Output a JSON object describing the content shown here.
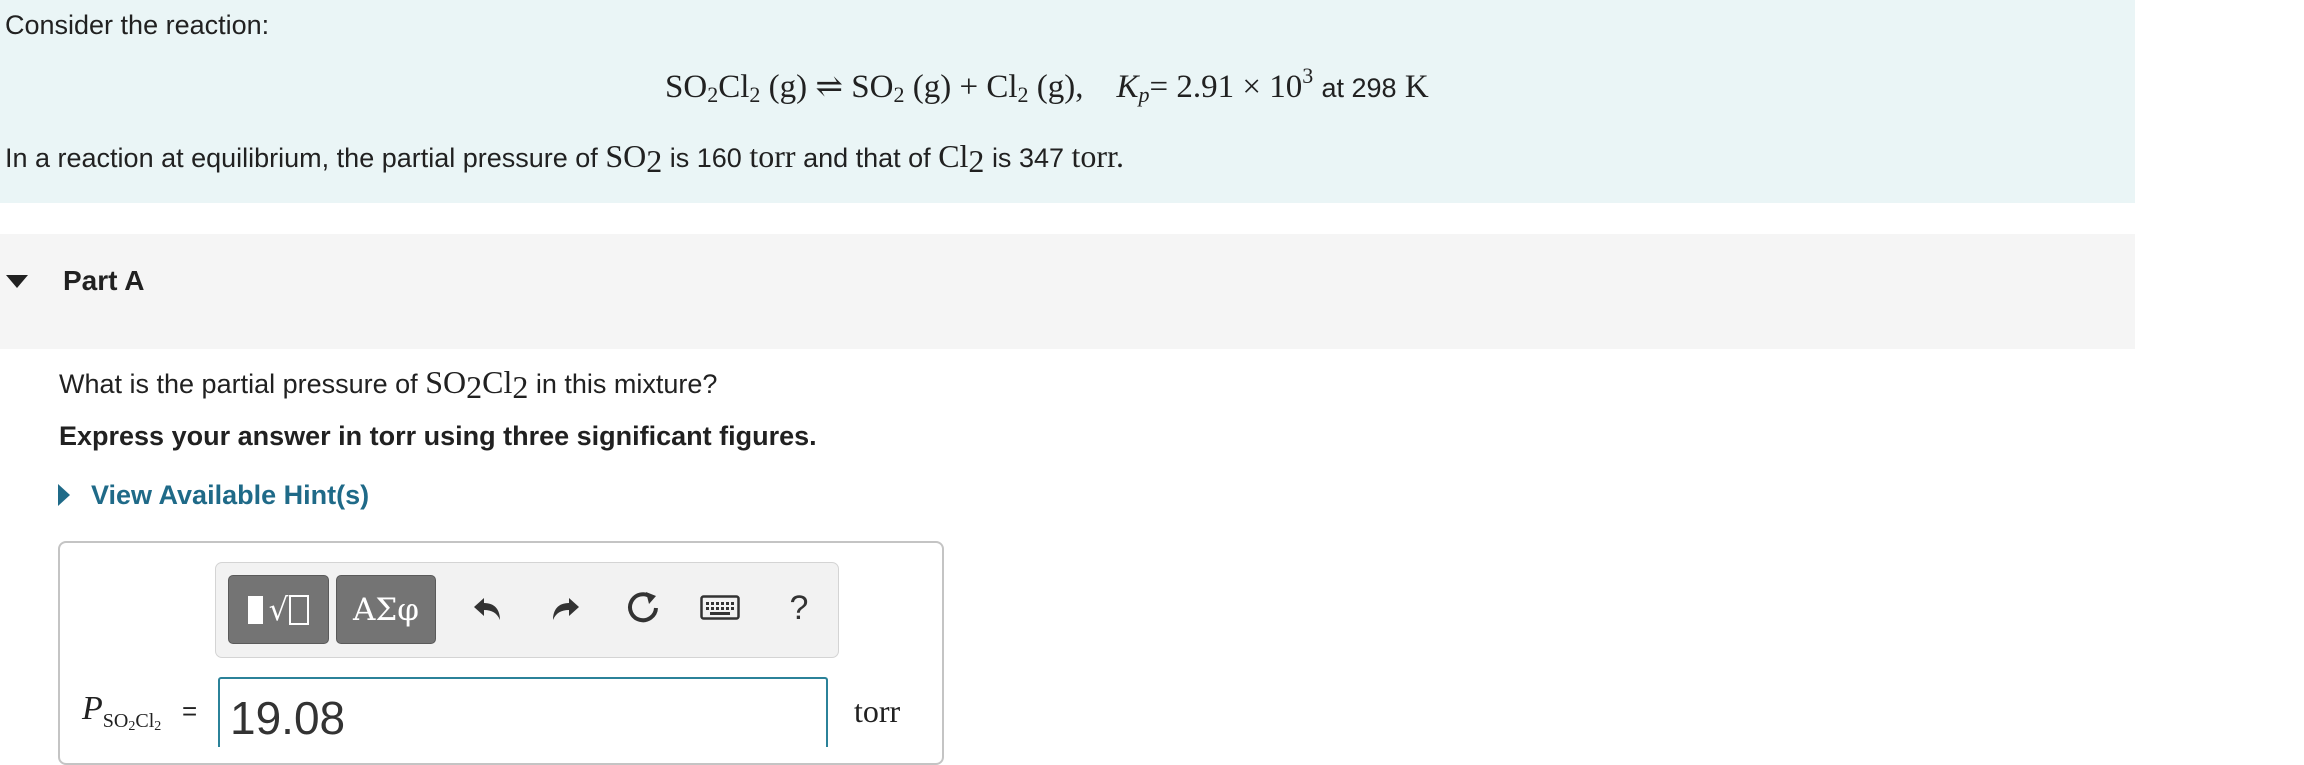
{
  "intro": {
    "heading": "Consider the reaction:",
    "equation": {
      "so2cl2_text": "SO",
      "sub2": "2",
      "cl_text": "Cl",
      "sub2b": "2",
      "gas": "(g)",
      "arrow": "⇌",
      "so2_text": "SO",
      "plus": "+",
      "cl2_text": "Cl",
      "comma": ",",
      "kp_symbol": "K",
      "kp_sub": "p",
      "kp_eq": "= 2.91 × 10",
      "kp_exp": "3",
      "at_text": "at 298",
      "kelvin": "K"
    },
    "equilibrium": {
      "part1": "In a reaction at equilibrium, the partial pressure of",
      "so2": "SO",
      "sub": "2",
      "part2": "is 160",
      "torr": "torr",
      "part3": "and that of",
      "cl2": "Cl",
      "part4": "is 347",
      "torr_end": "torr."
    }
  },
  "part": {
    "title": "Part A",
    "question": {
      "before": "What is the partial pressure of",
      "so": "SO",
      "sub2": "2",
      "cl": "Cl",
      "sub2b": "2",
      "after": "in this mixture?"
    },
    "instruction": "Express your answer in torr using three significant figures.",
    "hint_link": "View Available Hint(s)"
  },
  "toolbar": {
    "greek_label": "ΑΣφ",
    "radical_glyph": "√",
    "help_label": "?",
    "icons": [
      "templates-icon",
      "greek-symbols-icon",
      "undo-icon",
      "redo-icon",
      "reset-icon",
      "keyboard-icon",
      "help-icon"
    ]
  },
  "answer": {
    "var_symbol": "P",
    "var_sub": "SO",
    "var_sub_2": "2",
    "var_sub_cl": "Cl",
    "var_sub_2b": "2",
    "equals": "=",
    "value": "19.08",
    "unit": "torr"
  },
  "colors": {
    "intro_bg": "#eaf5f6",
    "header_bg": "#f5f5f5",
    "link": "#1f6a88",
    "toolbar_btn": "#747474",
    "input_border": "#2b8299"
  }
}
